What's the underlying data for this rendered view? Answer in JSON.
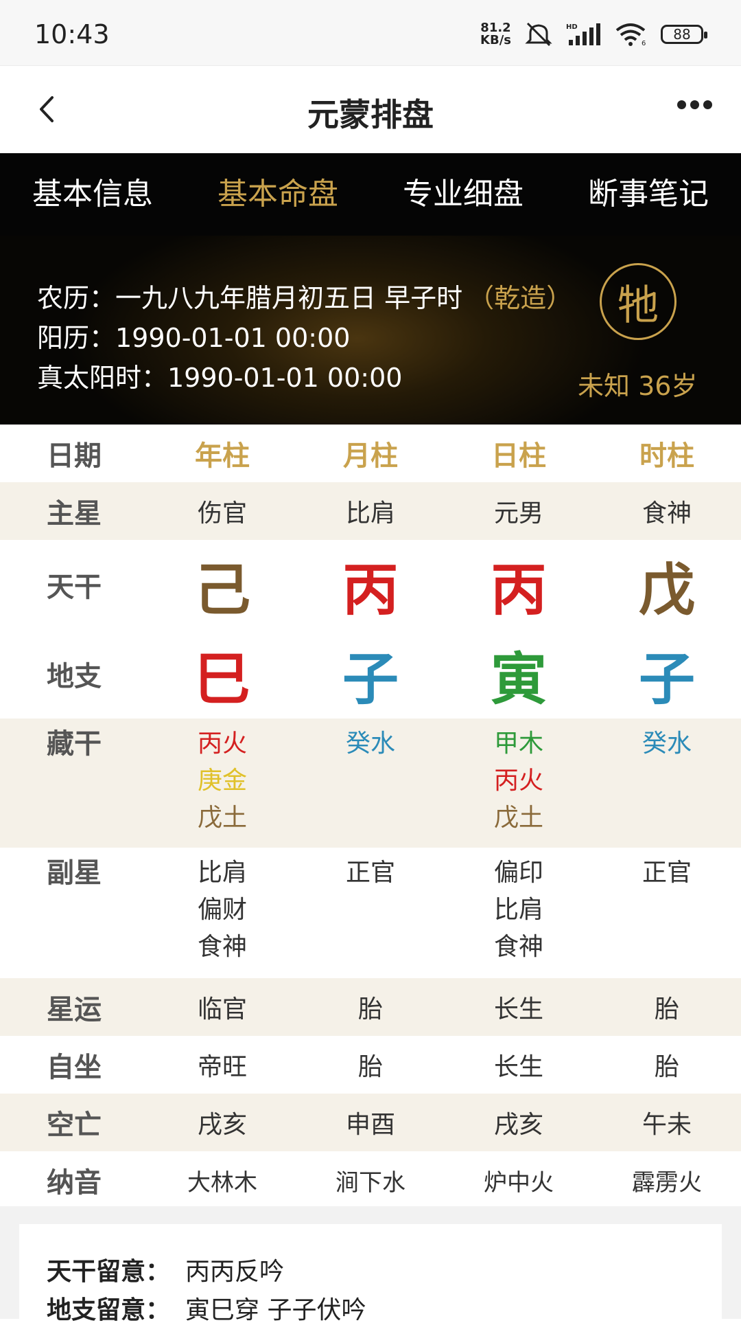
{
  "status_bar": {
    "time": "10:43",
    "net_speed_top": "81.2",
    "net_speed_bottom": "KB/s",
    "battery": "88",
    "icons": [
      "mute-icon",
      "hd-signal-icon",
      "wifi-icon",
      "battery-icon"
    ]
  },
  "nav": {
    "title": "元蒙排盘",
    "back_icon": "chevron-left-icon",
    "more_icon": "more-dots-icon"
  },
  "tabs": [
    {
      "label": "基本信息",
      "active": false
    },
    {
      "label": "基本命盘",
      "active": true
    },
    {
      "label": "专业细盘",
      "active": false
    },
    {
      "label": "断事笔记",
      "active": false
    }
  ],
  "info": {
    "lunar": "农历：一九八九年腊月初五日 早子时",
    "lunar_tag": "（乾造）",
    "solar": "阳历：1990-01-01 00:00",
    "true_solar": "真太阳时：1990-01-01 00:00",
    "seal_char": "牠",
    "zodiac_age": "未知  36岁"
  },
  "table": {
    "header": [
      "日期",
      "年柱",
      "月柱",
      "日柱",
      "时柱"
    ],
    "main_star": {
      "label": "主星",
      "values": [
        "伤官",
        "比肩",
        "元男",
        "食神"
      ]
    },
    "heaven_stem": {
      "label": "天干",
      "values": [
        "己",
        "丙",
        "丙",
        "戊"
      ],
      "colors": [
        "#7a5a2e",
        "#d42020",
        "#d42020",
        "#7a5a2e"
      ]
    },
    "earth_branch": {
      "label": "地支",
      "values": [
        "巳",
        "子",
        "寅",
        "子"
      ],
      "colors": [
        "#d42020",
        "#2b8bb8",
        "#2e9a3a",
        "#2b8bb8"
      ]
    },
    "hidden_stem": {
      "label": "藏干",
      "values": [
        [
          {
            "t": "丙火",
            "c": "#d42020"
          },
          {
            "t": "庚金",
            "c": "#e0c12a"
          },
          {
            "t": "戊土",
            "c": "#8a6a3a"
          }
        ],
        [
          {
            "t": "癸水",
            "c": "#2b8bb8"
          }
        ],
        [
          {
            "t": "甲木",
            "c": "#2e9a3a"
          },
          {
            "t": "丙火",
            "c": "#d42020"
          },
          {
            "t": "戊土",
            "c": "#8a6a3a"
          }
        ],
        [
          {
            "t": "癸水",
            "c": "#2b8bb8"
          }
        ]
      ]
    },
    "sub_star": {
      "label": "副星",
      "values": [
        [
          "比肩",
          "偏财",
          "食神"
        ],
        [
          "正官"
        ],
        [
          "偏印",
          "比肩",
          "食神"
        ],
        [
          "正官"
        ]
      ]
    },
    "star_luck": {
      "label": "星运",
      "values": [
        "临官",
        "胎",
        "长生",
        "胎"
      ]
    },
    "self_seat": {
      "label": "自坐",
      "values": [
        "帝旺",
        "胎",
        "长生",
        "胎"
      ]
    },
    "void": {
      "label": "空亡",
      "values": [
        "戌亥",
        "申酉",
        "戌亥",
        "午未"
      ]
    },
    "nayin": {
      "label": "纳音",
      "values": [
        "大林木",
        "涧下水",
        "炉中火",
        "霹雳火"
      ]
    }
  },
  "notes": {
    "stem_label": "天干留意：",
    "stem_value": "丙丙反吟",
    "branch_label": "地支留意：",
    "branch_value": "寅巳穿 子子伏吟"
  },
  "colors": {
    "accent_gold": "#c9a24d",
    "tab_bg": "#050505",
    "shade_row": "#f5f1e8"
  }
}
